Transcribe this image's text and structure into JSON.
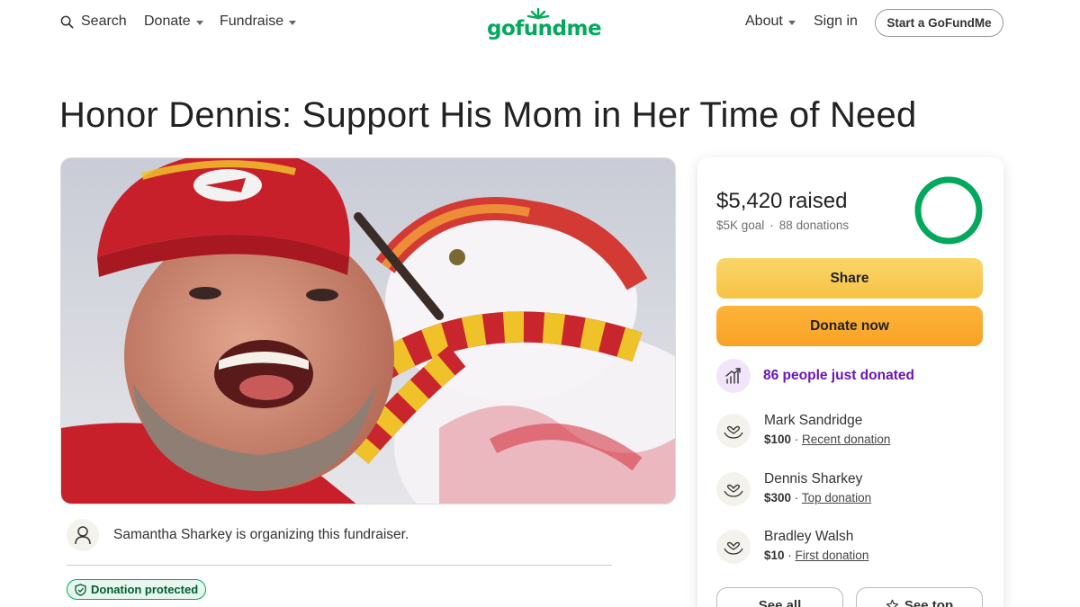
{
  "header": {
    "search_label": "Search",
    "donate_label": "Donate",
    "fundraise_label": "Fundraise",
    "logo_text": "gofundme",
    "about_label": "About",
    "signin_label": "Sign in",
    "start_label": "Start a GoFundMe"
  },
  "campaign": {
    "title": "Honor Dennis: Support His Mom in Her Time of Need",
    "organizer_text": "Samantha Sharkey is organizing this fundraiser.",
    "badge_label": "Donation protected"
  },
  "progress": {
    "raised_text": "$5,420 raised",
    "goal_text": "$5K goal",
    "separator": "·",
    "donations_text": "88 donations",
    "fraction": 1.0
  },
  "actions": {
    "share_label": "Share",
    "donate_now_label": "Donate now"
  },
  "trend": {
    "text": "86 people just donated"
  },
  "donors": [
    {
      "name": "Mark Sandridge",
      "amount": "$100",
      "sep": " · ",
      "tag": "Recent donation"
    },
    {
      "name": "Dennis Sharkey",
      "amount": "$300",
      "sep": " · ",
      "tag": "Top donation"
    },
    {
      "name": "Bradley Walsh",
      "amount": "$10",
      "sep": " · ",
      "tag": "First donation"
    }
  ],
  "footer_buttons": {
    "see_all_label": "See all",
    "see_top_label": "See top"
  },
  "colors": {
    "brand_green": "#02a95c",
    "share_yellow": "#f6c344",
    "donate_orange": "#f7a324",
    "trend_purple": "#6b14b8"
  },
  "icons": [
    "search-icon",
    "caret-down-icon",
    "logo-sun-icon",
    "user-icon",
    "shield-check-icon",
    "trend-up-icon",
    "heart-hands-icon",
    "star-icon"
  ]
}
